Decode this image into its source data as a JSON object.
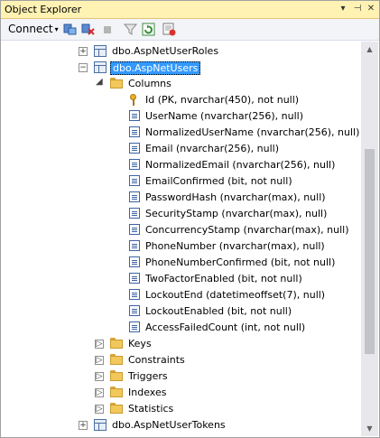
{
  "window": {
    "title": "Object Explorer",
    "pin_glyph": "▾",
    "autohide_glyph": "⊣",
    "close_glyph": "✕"
  },
  "toolbar": {
    "connect_label": "Connect",
    "connect_caret": "▾"
  },
  "tree": {
    "rows": [
      {
        "label": "dbo.AspNetUserRoles",
        "kind": "table",
        "expander": "+",
        "level": 0
      },
      {
        "label": "dbo.AspNetUsers",
        "kind": "table",
        "expander": "−",
        "level": 0,
        "selected": true
      },
      {
        "label": "Columns",
        "kind": "folder",
        "expander": "◢",
        "level": 1
      },
      {
        "label": "Id (PK, nvarchar(450), not null)",
        "kind": "key",
        "level": 2
      },
      {
        "label": "UserName (nvarchar(256), null)",
        "kind": "column",
        "level": 2
      },
      {
        "label": "NormalizedUserName (nvarchar(256), null)",
        "kind": "column",
        "level": 2
      },
      {
        "label": "Email (nvarchar(256), null)",
        "kind": "column",
        "level": 2
      },
      {
        "label": "NormalizedEmail (nvarchar(256), null)",
        "kind": "column",
        "level": 2
      },
      {
        "label": "EmailConfirmed (bit, not null)",
        "kind": "column",
        "level": 2
      },
      {
        "label": "PasswordHash (nvarchar(max), null)",
        "kind": "column",
        "level": 2
      },
      {
        "label": "SecurityStamp (nvarchar(max), null)",
        "kind": "column",
        "level": 2
      },
      {
        "label": "ConcurrencyStamp (nvarchar(max), null)",
        "kind": "column",
        "level": 2
      },
      {
        "label": "PhoneNumber (nvarchar(max), null)",
        "kind": "column",
        "level": 2
      },
      {
        "label": "PhoneNumberConfirmed (bit, not null)",
        "kind": "column",
        "level": 2
      },
      {
        "label": "TwoFactorEnabled (bit, not null)",
        "kind": "column",
        "level": 2
      },
      {
        "label": "LockoutEnd (datetimeoffset(7), null)",
        "kind": "column",
        "level": 2
      },
      {
        "label": "LockoutEnabled (bit, not null)",
        "kind": "column",
        "level": 2
      },
      {
        "label": "AccessFailedCount (int, not null)",
        "kind": "column",
        "level": 2
      },
      {
        "label": "Keys",
        "kind": "folder",
        "expander": "▷",
        "level": 1
      },
      {
        "label": "Constraints",
        "kind": "folder",
        "expander": "▷",
        "level": 1
      },
      {
        "label": "Triggers",
        "kind": "folder",
        "expander": "▷",
        "level": 1
      },
      {
        "label": "Indexes",
        "kind": "folder",
        "expander": "▷",
        "level": 1
      },
      {
        "label": "Statistics",
        "kind": "folder",
        "expander": "▷",
        "level": 1
      },
      {
        "label": "dbo.AspNetUserTokens",
        "kind": "table",
        "expander": "+",
        "level": 0
      }
    ]
  },
  "scrollbar": {
    "up_glyph": "▲",
    "down_glyph": "▼"
  }
}
